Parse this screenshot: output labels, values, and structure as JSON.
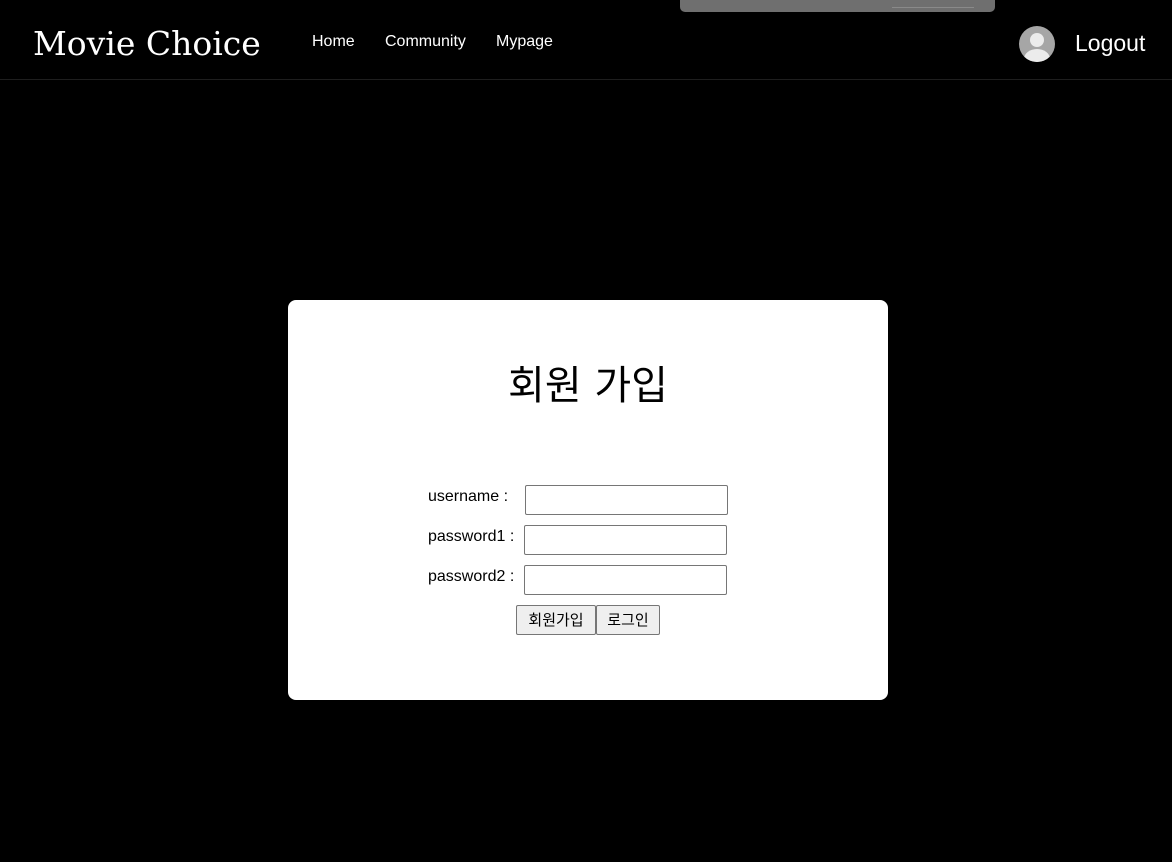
{
  "nav": {
    "brand": "Movie Choice",
    "links": [
      "Home",
      "Community",
      "Mypage"
    ],
    "logout": "Logout",
    "avatar_icon": "user-avatar-icon"
  },
  "signup": {
    "title": "회원 가입",
    "username_label": "username :",
    "password1_label": "password1 :",
    "password2_label": "password2 :",
    "username_value": "",
    "password1_value": "",
    "password2_value": "",
    "submit_label": "회원가입",
    "login_label": "로그인"
  },
  "colors": {
    "page_background": "#000000",
    "card_background": "#ffffff",
    "avatar": "#a6a6a6"
  }
}
